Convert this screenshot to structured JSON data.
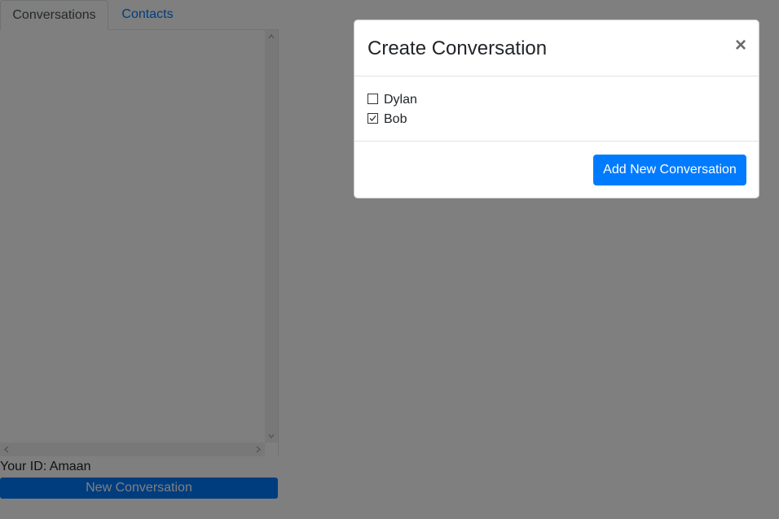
{
  "sidebar": {
    "tabs": [
      {
        "label": "Conversations",
        "active": true
      },
      {
        "label": "Contacts",
        "active": false
      }
    ],
    "your_id": "Your ID: Amaan",
    "new_conversation_label": "New Conversation"
  },
  "modal": {
    "title": "Create Conversation",
    "close_symbol": "×",
    "contacts": [
      {
        "name": "Dylan",
        "checked": false
      },
      {
        "name": "Bob",
        "checked": true
      }
    ],
    "submit_label": "Add New Conversation"
  },
  "colors": {
    "accent": "#007bff",
    "backdrop": "rgba(0,0,0,0.5)"
  },
  "icons": {
    "close": "close-icon",
    "scroll_up": "chevron-up-icon",
    "scroll_down": "chevron-down-icon",
    "scroll_left": "chevron-left-icon",
    "scroll_right": "chevron-right-icon",
    "checkmark": "checkmark-icon"
  }
}
